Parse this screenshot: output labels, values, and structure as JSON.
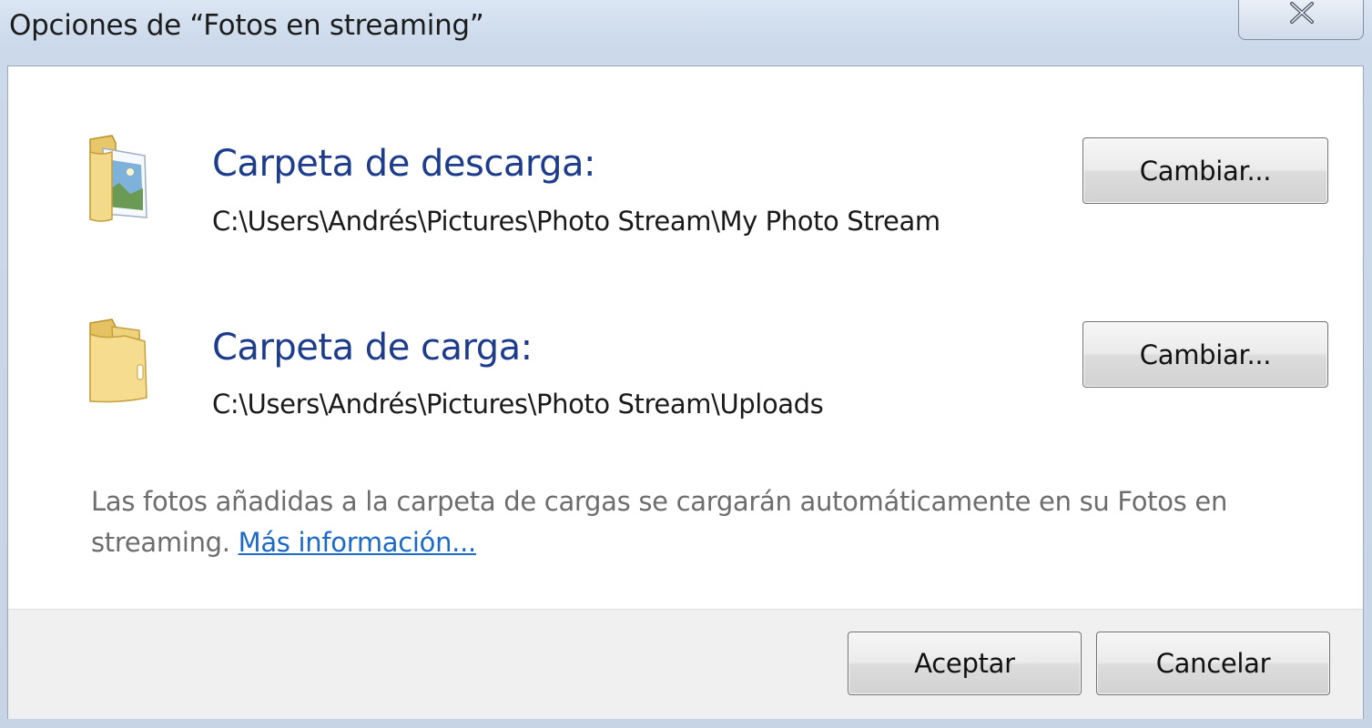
{
  "window": {
    "title": "Opciones de “Fotos en streaming”"
  },
  "download": {
    "heading": "Carpeta de descarga:",
    "path": "C:\\Users\\Andrés\\Pictures\\Photo Stream\\My Photo Stream",
    "change_label": "Cambiar..."
  },
  "upload": {
    "heading": "Carpeta de carga:",
    "path": "C:\\Users\\Andrés\\Pictures\\Photo Stream\\Uploads",
    "change_label": "Cambiar..."
  },
  "info": {
    "text": "Las fotos añadidas a la carpeta de cargas se cargarán automáticamente en su Fotos en streaming. ",
    "link": "Más información..."
  },
  "footer": {
    "ok_label": "Aceptar",
    "cancel_label": "Cancelar"
  },
  "icons": {
    "close": "close-icon",
    "download_folder": "pictures-folder-icon",
    "upload_folder": "folder-icon"
  },
  "colors": {
    "heading": "#1e3c8c",
    "link": "#1b6ac9",
    "footer_bg": "#f0f0f0"
  }
}
